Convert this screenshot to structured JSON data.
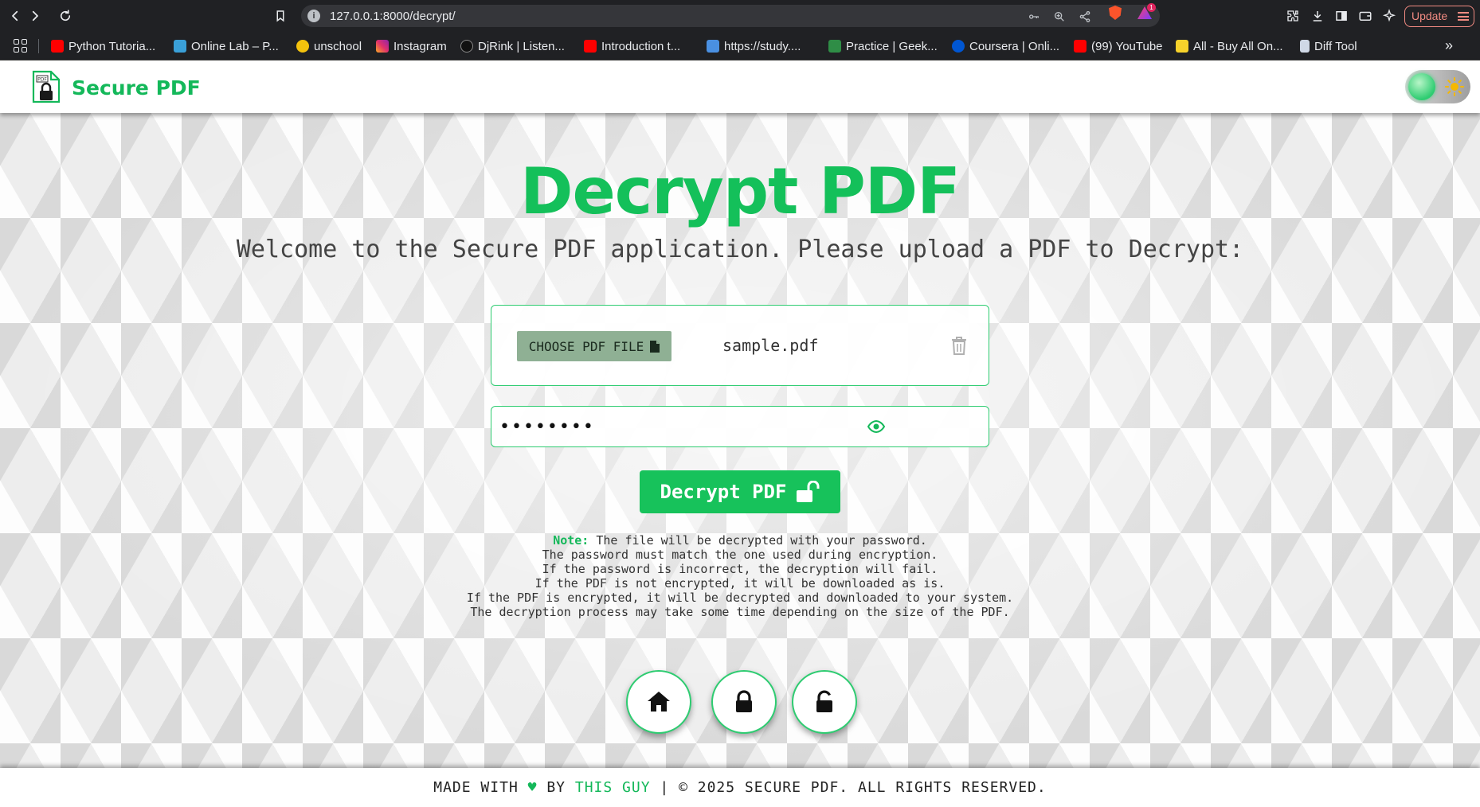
{
  "browser": {
    "url": "127.0.0.1:8000/decrypt/",
    "update_label": "Update",
    "bookmarks": [
      {
        "label": "Python Tutoria...",
        "color": "#ff0000"
      },
      {
        "label": "Online Lab – P...",
        "color": "#3aa0d8"
      },
      {
        "label": "unschool",
        "color": "#f4c20d"
      },
      {
        "label": "Instagram",
        "color": "#e1306c"
      },
      {
        "label": "DjRink | Listen...",
        "color": "#111111"
      },
      {
        "label": "Introduction t...",
        "color": "#ff0000"
      },
      {
        "label": "https://study....",
        "color": "#4a90e2"
      },
      {
        "label": "Practice | Geek...",
        "color": "#2f8d46"
      },
      {
        "label": "Coursera | Onli...",
        "color": "#0056d2"
      },
      {
        "label": "(99) YouTube",
        "color": "#ff0000"
      },
      {
        "label": "All - Buy All On...",
        "color": "#f7d22b"
      },
      {
        "label": "Diff Tool",
        "color": "#cfd8e6"
      }
    ]
  },
  "header": {
    "brand": "Secure PDF",
    "logo_icon": "pdf-lock-icon"
  },
  "main": {
    "title": "Decrypt PDF",
    "welcome": "Welcome to the Secure PDF application. Please upload a PDF to Decrypt:",
    "choose_label": "CHOOSE PDF FILE",
    "file_name": "sample.pdf",
    "password_value": "••••••••",
    "decrypt_label": "Decrypt PDF",
    "note_label": "Note:",
    "note_lines": [
      "The file will be decrypted with your password.",
      "The password must match the one used during encryption.",
      "If the password is incorrect, the decryption will fail.",
      "If the PDF is not encrypted, it will be downloaded as is.",
      "If the PDF is encrypted, it will be decrypted and downloaded to your system.",
      "The decryption process may take some time depending on the size of the PDF."
    ]
  },
  "footer": {
    "made_with": "MADE WITH",
    "heart": "♥",
    "by": "BY",
    "guy": "THIS GUY",
    "rights": "| © 2025 SECURE PDF. ALL RIGHTS RESERVED."
  },
  "colors": {
    "accent": "#14c05a",
    "border": "#2ecc71",
    "choose_button": "#8fb094"
  }
}
